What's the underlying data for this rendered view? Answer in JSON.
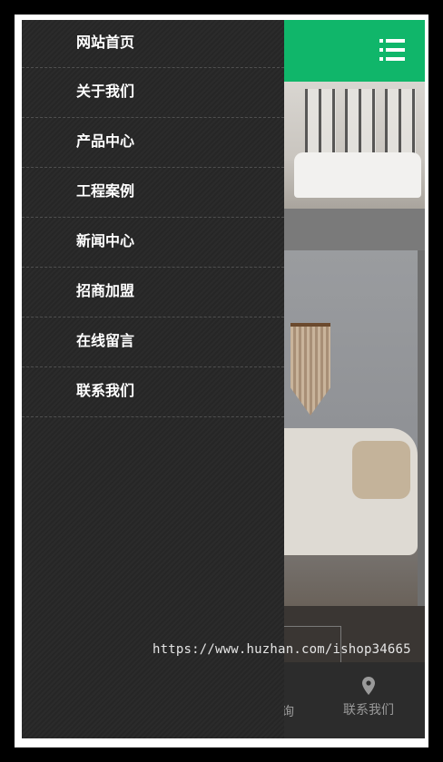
{
  "menu": {
    "items": [
      {
        "label": "网站首页"
      },
      {
        "label": "关于我们"
      },
      {
        "label": "产品中心"
      },
      {
        "label": "工程案例"
      },
      {
        "label": "新闻中心"
      },
      {
        "label": "招商加盟"
      },
      {
        "label": "在线留言"
      },
      {
        "label": "联系我们"
      }
    ]
  },
  "header": {
    "accent": "#10b66a",
    "menu_icon": "list-icon"
  },
  "bottom_nav": {
    "partial_label": "询",
    "contact_label": "联系我们",
    "contact_icon": "map-pin-icon"
  },
  "watermark": "https://www.huzhan.com/ishop34665"
}
